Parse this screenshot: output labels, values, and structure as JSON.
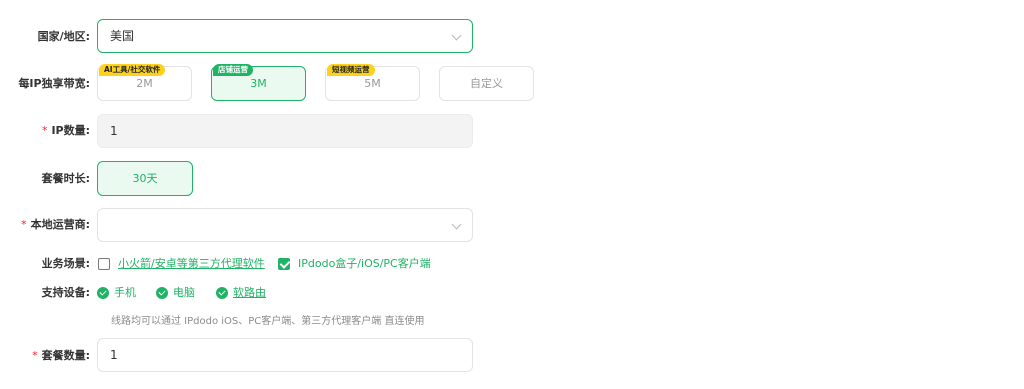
{
  "country": {
    "label": "国家/地区:",
    "value": "美国"
  },
  "bandwidth": {
    "label": "每IP独享带宽:",
    "options": [
      {
        "label": "2M",
        "tag": "AI工具/社交软件"
      },
      {
        "label": "3M",
        "tag": "店铺运营"
      },
      {
        "label": "5M",
        "tag": "短视频运营"
      },
      {
        "label": "自定义"
      }
    ],
    "selected": "3M"
  },
  "ip_count": {
    "label": "IP数量:",
    "value": "1"
  },
  "duration": {
    "label": "套餐时长:",
    "value": "30天"
  },
  "isp": {
    "label": "本地运营商:",
    "value": ""
  },
  "scenario": {
    "label": "业务场景:",
    "options": [
      {
        "label": "小火箭/安卓等第三方代理软件",
        "checked": false
      },
      {
        "label": "IPdodo盒子/iOS/PC客户端",
        "checked": true
      }
    ]
  },
  "devices": {
    "label": "支持设备:",
    "items": [
      "手机",
      "电脑",
      "软路由"
    ],
    "note": "线路均可以通过 IPdodo iOS、PC客户端、第三方代理客户端 直连使用"
  },
  "quantity": {
    "label": "套餐数量:",
    "value": "1"
  },
  "required_mark": "*",
  "colors": {
    "accent": "#20b365",
    "tag_yellow": "#fcd21f",
    "required": "#f5222d"
  }
}
